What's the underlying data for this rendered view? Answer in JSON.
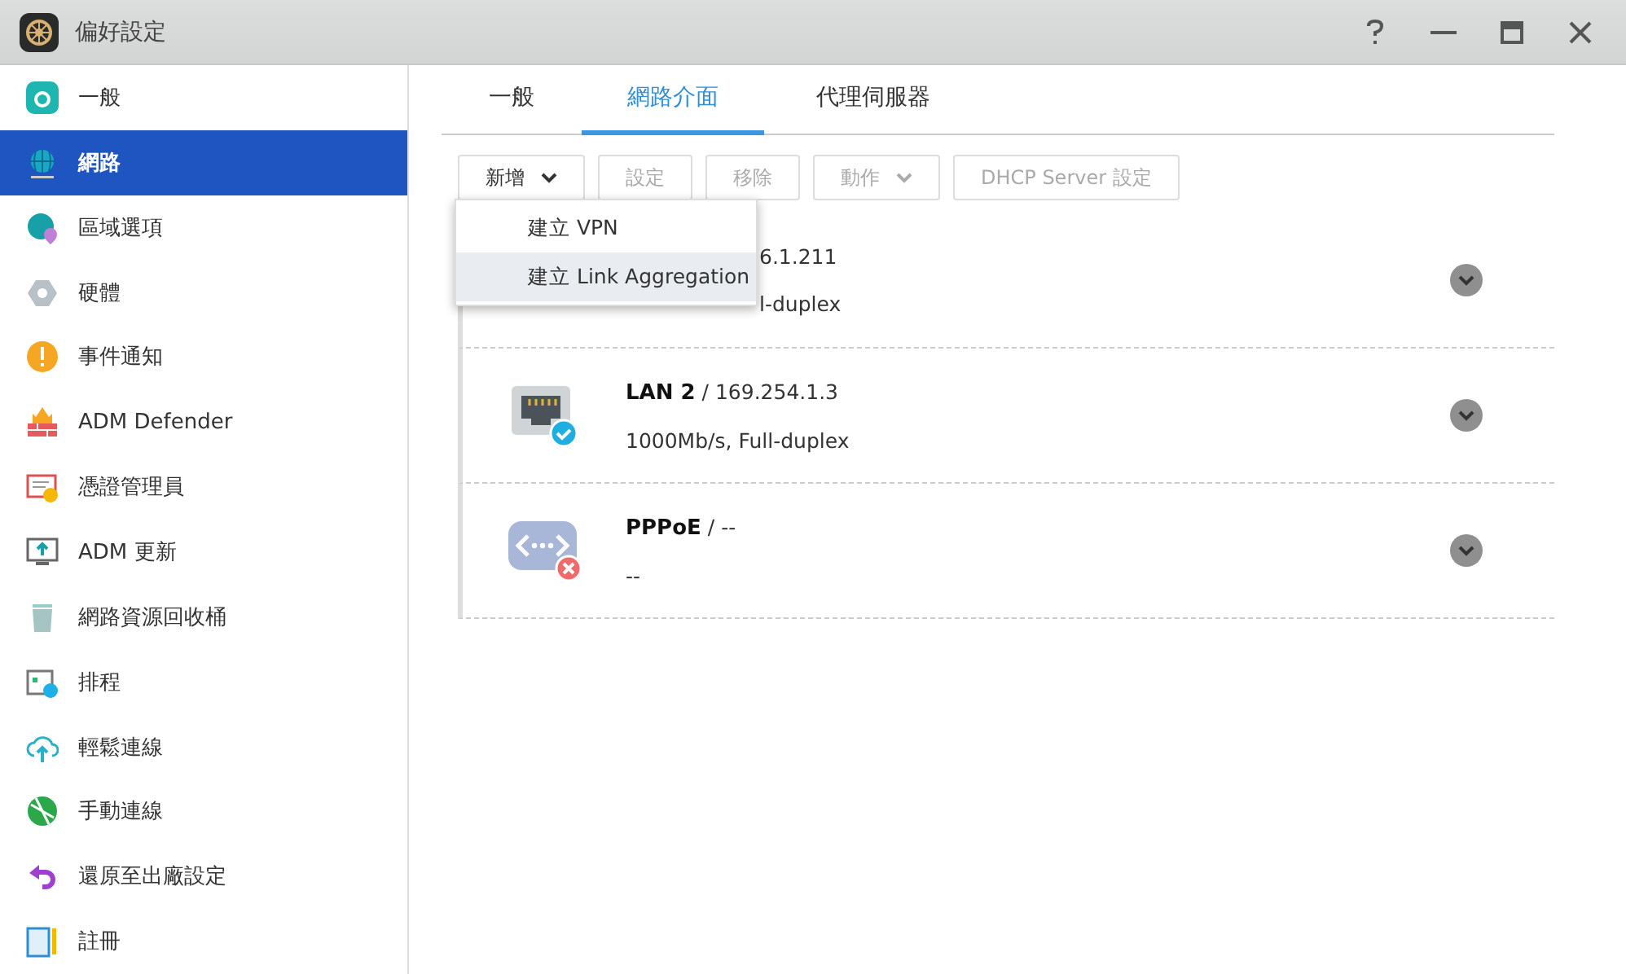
{
  "window": {
    "title": "偏好設定"
  },
  "sidebar": {
    "items": [
      {
        "label": "一般",
        "selected": false
      },
      {
        "label": "網路",
        "selected": true
      },
      {
        "label": "區域選項",
        "selected": false
      },
      {
        "label": "硬體",
        "selected": false
      },
      {
        "label": "事件通知",
        "selected": false
      },
      {
        "label": "ADM Defender",
        "selected": false
      },
      {
        "label": "憑證管理員",
        "selected": false
      },
      {
        "label": "ADM 更新",
        "selected": false
      },
      {
        "label": "網路資源回收桶",
        "selected": false
      },
      {
        "label": "排程",
        "selected": false
      },
      {
        "label": "輕鬆連線",
        "selected": false
      },
      {
        "label": "手動連線",
        "selected": false
      },
      {
        "label": "還原至出廠設定",
        "selected": false
      },
      {
        "label": "註冊",
        "selected": false
      }
    ]
  },
  "tabs": [
    {
      "label": "一般",
      "selected": false
    },
    {
      "label": "網路介面",
      "selected": true
    },
    {
      "label": "代理伺服器",
      "selected": false
    }
  ],
  "toolbar": [
    {
      "label": "新增",
      "dropdown": true,
      "disabled": false
    },
    {
      "label": "設定",
      "dropdown": false,
      "disabled": true
    },
    {
      "label": "移除",
      "dropdown": false,
      "disabled": true
    },
    {
      "label": "動作",
      "dropdown": true,
      "disabled": true
    },
    {
      "label": "DHCP Server 設定",
      "dropdown": false,
      "disabled": true
    }
  ],
  "dropdown_menu": [
    {
      "label": "建立 VPN",
      "selected": false
    },
    {
      "label": "建立 Link Aggregation",
      "selected": true
    }
  ],
  "interfaces": [
    {
      "kind": "partial",
      "address": "6.1.211",
      "detail": "l-duplex"
    },
    {
      "kind": "lan",
      "name": "LAN 2",
      "address": " / 169.254.1.3",
      "detail": "1000Mb/s, Full-duplex",
      "connected": true
    },
    {
      "kind": "pppoe",
      "name": "PPPoE",
      "address": " / --",
      "detail": "--",
      "connected": false
    }
  ]
}
